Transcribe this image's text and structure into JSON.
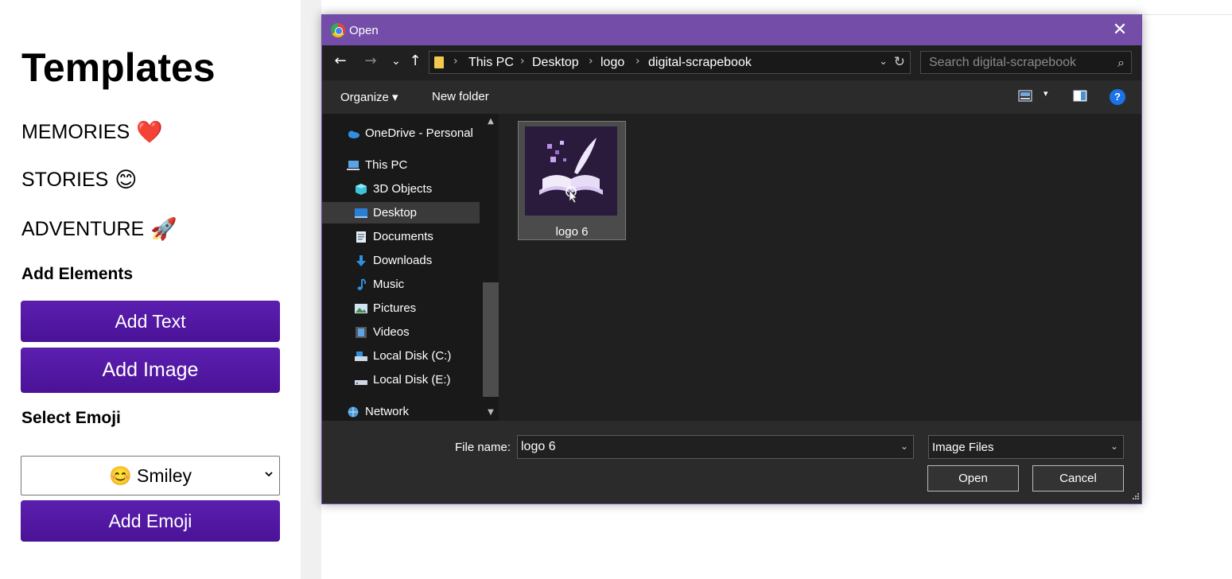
{
  "sidebar": {
    "title": "Templates",
    "templates": [
      {
        "label": "MEMORIES",
        "emoji": "❤️",
        "icon": "heart-icon"
      },
      {
        "label": "STORIES",
        "emoji": "😊",
        "icon": "smiley-icon"
      },
      {
        "label": "ADVENTURE",
        "emoji": "🚀",
        "icon": "rocket-icon"
      }
    ],
    "add_elements_title": "Add Elements",
    "add_text_label": "Add Text",
    "add_image_label": "Add Image",
    "select_emoji_title": "Select Emoji",
    "emoji_select_value": "😊 Smiley",
    "add_emoji_label": "Add Emoji"
  },
  "dialog": {
    "title": "Open",
    "close_glyph": "✕",
    "nav": {
      "back": "←",
      "forward": "→",
      "recent": "⌄",
      "up": "↑"
    },
    "breadcrumb": [
      "This PC",
      "Desktop",
      "logo",
      "digital-scrapebook"
    ],
    "search_placeholder": "Search digital-scrapebook",
    "toolbar": {
      "organize_label": "Organize ▾",
      "new_folder_label": "New folder",
      "help": "?"
    },
    "nav_pane": [
      {
        "label": "OneDrive - Personal",
        "icon": "onedrive-icon",
        "selected": false
      },
      {
        "label": "This PC",
        "icon": "computer-icon",
        "selected": false
      },
      {
        "label": "3D Objects",
        "icon": "cube-icon",
        "selected": false
      },
      {
        "label": "Desktop",
        "icon": "desktop-icon",
        "selected": true
      },
      {
        "label": "Documents",
        "icon": "documents-icon",
        "selected": false
      },
      {
        "label": "Downloads",
        "icon": "downloads-icon",
        "selected": false
      },
      {
        "label": "Music",
        "icon": "music-icon",
        "selected": false
      },
      {
        "label": "Pictures",
        "icon": "pictures-icon",
        "selected": false
      },
      {
        "label": "Videos",
        "icon": "videos-icon",
        "selected": false
      },
      {
        "label": "Local Disk (C:)",
        "icon": "disk-icon",
        "selected": false
      },
      {
        "label": "Local Disk (E:)",
        "icon": "disk-icon",
        "selected": false
      },
      {
        "label": "Network",
        "icon": "network-icon",
        "selected": false
      }
    ],
    "files": [
      {
        "name": "logo 6",
        "type": "image"
      }
    ],
    "footer": {
      "file_name_label": "File name:",
      "file_name_value": "logo 6",
      "file_type_value": "Image Files",
      "open_label": "Open",
      "cancel_label": "Cancel"
    }
  },
  "colors": {
    "accent_purple": "#5b1fb0",
    "titlebar": "#744da9",
    "dialog_bg": "#202020",
    "help_blue": "#1a73e8"
  }
}
